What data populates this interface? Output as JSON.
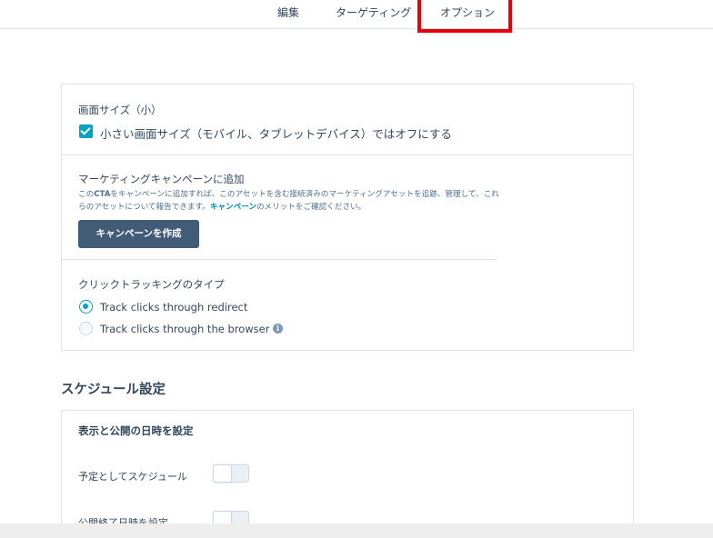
{
  "tabs": {
    "edit": "編集",
    "targeting": "ターゲティング",
    "options": "オプション"
  },
  "screen_size": {
    "label": "画面サイズ（小）",
    "checkbox_label": "小さい画面サイズ（モバイル、タブレットデバイス）ではオフにする",
    "checked": true
  },
  "campaign": {
    "label": "マーケティングキャンペーンに追加",
    "desc_part1": "この",
    "desc_cta": "CTA",
    "desc_part2": "をキャンペーンに追加すれば、このアセットを含む接続済みのマーケティングアセットを追跡、管理して、これらのアセットについて報告できます。",
    "desc_link": "キャンペーン",
    "desc_part3": "のメリットをご確認ください。",
    "button": "キャンペーンを作成"
  },
  "click_tracking": {
    "label": "クリックトラッキングのタイプ",
    "options": [
      {
        "label": "Track clicks through redirect",
        "selected": true
      },
      {
        "label": "Track clicks through the browser",
        "selected": false
      }
    ],
    "info_glyph": "i"
  },
  "schedule": {
    "heading": "スケジュール設定",
    "card_title": "表示と公開の日時を設定",
    "toggles": [
      {
        "label": "予定としてスケジュール",
        "on": false
      },
      {
        "label": "公開終了日時を設定",
        "on": false
      }
    ]
  },
  "colors": {
    "accent": "#00a4bd",
    "button": "#425b76",
    "link": "#0091ae",
    "highlight": "#e8000b"
  }
}
